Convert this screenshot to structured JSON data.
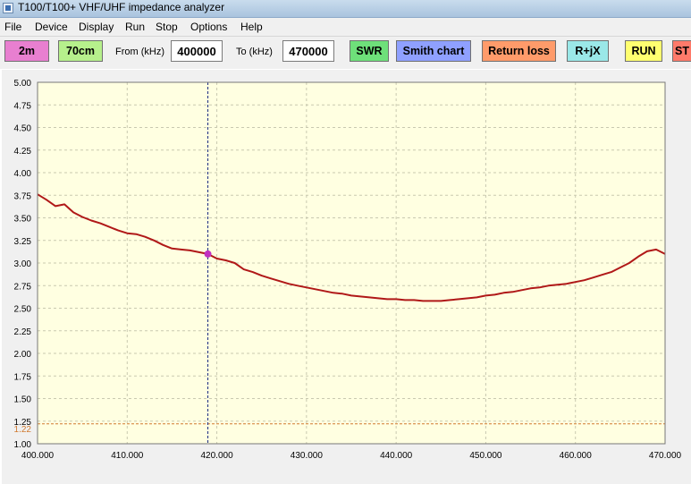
{
  "window": {
    "title": "T100/T100+ VHF/UHF impedance analyzer"
  },
  "menu": [
    "File",
    "Device",
    "Display",
    "Run",
    "Stop",
    "Options",
    "Help"
  ],
  "toolbar": {
    "band_2m": "2m",
    "band_70cm": "70cm",
    "from_label": "From (kHz)",
    "from_value": "400000",
    "to_label": "To (kHz)",
    "to_value": "470000",
    "swr": "SWR",
    "smith": "Smith chart",
    "return_loss": "Return loss",
    "rjx": "R+jX",
    "run": "RUN",
    "stop": "ST",
    "colors": {
      "band": "#e87fd0",
      "band70": "#b6f08c",
      "swr": "#6ee07a",
      "smith": "#8fa0ff",
      "return_loss": "#ff9b6a",
      "rjx": "#9ae8e8",
      "run": "#ffff70",
      "stop": "#ff7a6a"
    }
  },
  "chart_data": {
    "type": "line",
    "xlim": [
      400,
      470
    ],
    "ylim": [
      1.0,
      5.0
    ],
    "x_ticks": [
      "400.000",
      "410.000",
      "420.000",
      "430.000",
      "440.000",
      "450.000",
      "460.000",
      "470.000"
    ],
    "y_ticks": [
      "5.00",
      "4.75",
      "4.50",
      "4.25",
      "4.00",
      "3.75",
      "3.50",
      "3.25",
      "3.00",
      "2.75",
      "2.50",
      "2.25",
      "2.00",
      "1.75",
      "1.50",
      "1.25",
      "1.00"
    ],
    "grid": true,
    "background": "#ffffe1",
    "series_color": "#b01818",
    "x": [
      400,
      401,
      402,
      403,
      404,
      405,
      406,
      407,
      408,
      409,
      410,
      411,
      412,
      413,
      414,
      415,
      416,
      417,
      418,
      419,
      420,
      421,
      422,
      423,
      424,
      425,
      426,
      427,
      428,
      429,
      430,
      431,
      432,
      433,
      434,
      435,
      436,
      437,
      438,
      439,
      440,
      441,
      442,
      443,
      444,
      445,
      446,
      447,
      448,
      449,
      450,
      451,
      452,
      453,
      454,
      455,
      456,
      457,
      458,
      459,
      460,
      461,
      462,
      463,
      464,
      465,
      466,
      467,
      468,
      469,
      470
    ],
    "y": [
      3.76,
      3.7,
      3.63,
      3.65,
      3.56,
      3.51,
      3.47,
      3.44,
      3.4,
      3.36,
      3.33,
      3.32,
      3.29,
      3.25,
      3.2,
      3.16,
      3.15,
      3.14,
      3.12,
      3.1,
      3.05,
      3.03,
      3.0,
      2.93,
      2.9,
      2.86,
      2.83,
      2.8,
      2.77,
      2.75,
      2.73,
      2.71,
      2.69,
      2.67,
      2.66,
      2.64,
      2.63,
      2.62,
      2.61,
      2.6,
      2.6,
      2.59,
      2.59,
      2.58,
      2.58,
      2.58,
      2.59,
      2.6,
      2.61,
      2.62,
      2.64,
      2.65,
      2.67,
      2.68,
      2.7,
      2.72,
      2.73,
      2.75,
      2.76,
      2.77,
      2.79,
      2.81,
      2.84,
      2.87,
      2.9,
      2.95,
      3.0,
      3.07,
      3.13,
      3.15,
      3.1
    ],
    "cursor": {
      "x": 419,
      "y": 3.1,
      "color": "#c030c0"
    },
    "threshold": {
      "value": 1.22,
      "label": "1.22",
      "color": "#d07a30"
    }
  }
}
